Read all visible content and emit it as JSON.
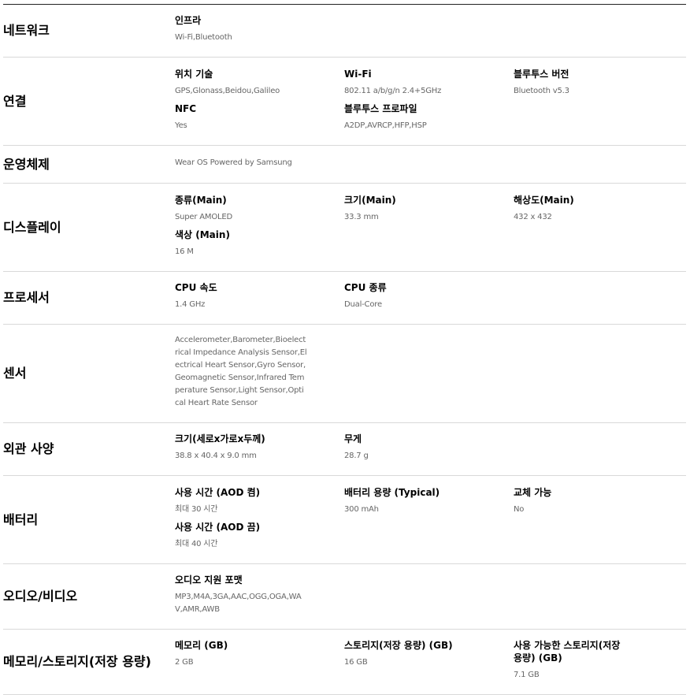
{
  "rows": [
    {
      "category": "네트워크",
      "items": [
        {
          "label": "인프라",
          "value": "Wi-Fi,Bluetooth"
        }
      ]
    },
    {
      "category": "연결",
      "items": [
        {
          "label": "위치 기술",
          "value": "GPS,Glonass,Beidou,Galileo"
        },
        {
          "label": "Wi-Fi",
          "value": "802.11 a/b/g/n 2.4+5GHz"
        },
        {
          "label": "블루투스 버전",
          "value": "Bluetooth v5.3"
        },
        {
          "label": "NFC",
          "value": "Yes"
        },
        {
          "label": "블루투스 프로파일",
          "value": "A2DP,AVRCP,HFP,HSP"
        }
      ]
    },
    {
      "category": "운영체제",
      "items": [
        {
          "label": "",
          "value": "Wear OS Powered by Samsung"
        }
      ]
    },
    {
      "category": "디스플레이",
      "items": [
        {
          "label": "종류(Main)",
          "value": "Super AMOLED"
        },
        {
          "label": "크기(Main)",
          "value": "33.3 mm"
        },
        {
          "label": "해상도(Main)",
          "value": "432 x 432"
        },
        {
          "label": "색상 (Main)",
          "value": "16 M"
        }
      ]
    },
    {
      "category": "프로세서",
      "items": [
        {
          "label": "CPU 속도",
          "value": "1.4 GHz"
        },
        {
          "label": "CPU 종류",
          "value": "Dual-Core"
        }
      ]
    },
    {
      "category": "센서",
      "items": [
        {
          "label": "",
          "value": "Accelerometer,Barometer,Bioelectrical Impedance Analysis Sensor,Electrical Heart Sensor,Gyro Sensor,Geomagnetic Sensor,Infrared Temperature Sensor,Light Sensor,Optical Heart Rate Sensor"
        }
      ]
    },
    {
      "category": "외관 사양",
      "items": [
        {
          "label": "크기(세로x가로x두께)",
          "value": "38.8 x 40.4 x 9.0 mm"
        },
        {
          "label": "무게",
          "value": "28.7 g"
        }
      ]
    },
    {
      "category": "배터리",
      "items": [
        {
          "label": "사용 시간 (AOD 켬)",
          "value": "최대 30 시간"
        },
        {
          "label": "배터리 용량 (Typical)",
          "value": "300 mAh"
        },
        {
          "label": "교체 가능",
          "value": "No"
        },
        {
          "label": "사용 시간 (AOD 끔)",
          "value": "최대 40 시간"
        }
      ]
    },
    {
      "category": "오디오/비디오",
      "items": [
        {
          "label": "오디오 지원 포맷",
          "value": "MP3,M4A,3GA,AAC,OGG,OGA,WAV,AMR,AWB"
        }
      ]
    },
    {
      "category": "메모리/스토리지(저장 용량)",
      "items": [
        {
          "label": "메모리 (GB)",
          "value": "2 GB"
        },
        {
          "label": "스토리지(저장 용량) (GB)",
          "value": "16 GB"
        },
        {
          "label": "사용 가능한 스토리지(저장 용량) (GB)",
          "value": "7.1 GB"
        }
      ]
    }
  ]
}
